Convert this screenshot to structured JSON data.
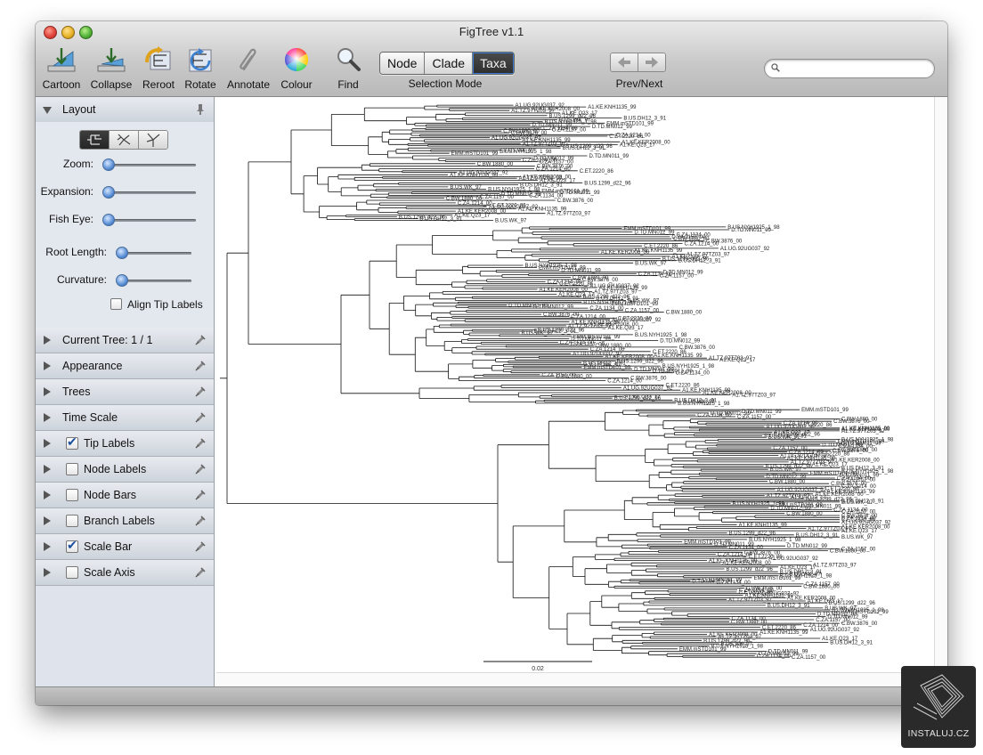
{
  "window": {
    "title": "FigTree v1.1"
  },
  "toolbar": {
    "tools": [
      {
        "label": "Cartoon",
        "icon": "cartoon-icon"
      },
      {
        "label": "Collapse",
        "icon": "collapse-icon"
      },
      {
        "label": "Reroot",
        "icon": "reroot-icon"
      },
      {
        "label": "Rotate",
        "icon": "rotate-icon"
      },
      {
        "label": "Annotate",
        "icon": "paperclip-icon"
      },
      {
        "label": "Colour",
        "icon": "color-wheel-icon"
      },
      {
        "label": "Find",
        "icon": "magnifier-icon"
      }
    ],
    "selection_mode": {
      "options": [
        "Node",
        "Clade",
        "Taxa"
      ],
      "selected": "Taxa",
      "label": "Selection Mode"
    },
    "prev_next": {
      "label": "Prev/Next"
    },
    "search": {
      "value": "",
      "placeholder": ""
    }
  },
  "sidebar": {
    "layout": {
      "title": "Layout",
      "sliders": [
        {
          "label": "Zoom:",
          "value": 0
        },
        {
          "label": "Expansion:",
          "value": 0
        },
        {
          "label": "Fish Eye:",
          "value": 0
        },
        {
          "label": "Root Length:",
          "value": 0
        },
        {
          "label": "Curvature:",
          "value": 0
        }
      ],
      "align_tip_labels": {
        "label": "Align Tip Labels",
        "checked": false
      }
    },
    "sections": [
      {
        "label": "Current Tree: 1 / 1",
        "has_checkbox": false,
        "checked": false
      },
      {
        "label": "Appearance",
        "has_checkbox": false,
        "checked": false
      },
      {
        "label": "Trees",
        "has_checkbox": false,
        "checked": false
      },
      {
        "label": "Time Scale",
        "has_checkbox": false,
        "checked": false
      },
      {
        "label": "Tip Labels",
        "has_checkbox": true,
        "checked": true
      },
      {
        "label": "Node Labels",
        "has_checkbox": true,
        "checked": false
      },
      {
        "label": "Node Bars",
        "has_checkbox": true,
        "checked": false
      },
      {
        "label": "Branch Labels",
        "has_checkbox": true,
        "checked": false
      },
      {
        "label": "Scale Bar",
        "has_checkbox": true,
        "checked": true
      },
      {
        "label": "Scale Axis",
        "has_checkbox": true,
        "checked": false
      }
    ]
  },
  "tree": {
    "scale_bar_label": "0.02",
    "visible_tip_labels": [
      "A1.UG.92UG037_92",
      "A1.KE.KNH1135_99",
      "A1.KE.KER2008_00",
      "A1.TZ.97TZ03_97",
      "A1.KE.Q23_17",
      "B.US.1299_d22_96",
      "B.US.DH12_3_91",
      "B.US.WK_97",
      "B.US.NYH1925_1_98",
      "EMM.mSTD101_99",
      "D.TD.MN011_99",
      "D.TD.MN012_99",
      "C.ZA.1134_00",
      "C.ZA.1157_00",
      "C.BW.1880_00",
      "C.BW.3876_00",
      "C.ZA.1214_00",
      "C.ET.2220_86"
    ],
    "colors": {
      "branch": "#111111",
      "label": "#222222"
    }
  },
  "watermark": {
    "text": "INSTALUJ.CZ"
  }
}
